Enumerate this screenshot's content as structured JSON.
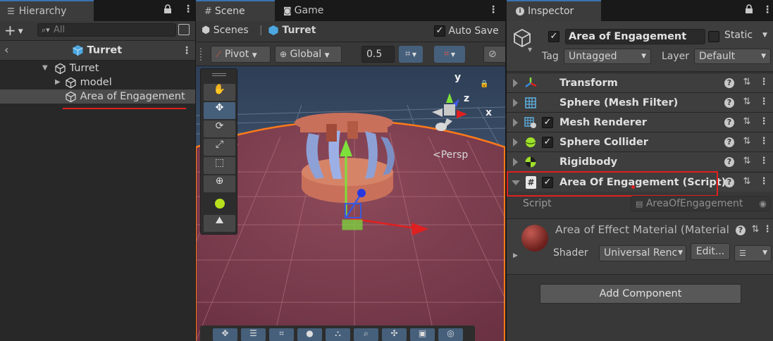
{
  "hierarchy": {
    "tab_label": "Hierarchy",
    "search_placeholder": "All",
    "scene_root": "Turret",
    "items": [
      {
        "label": "Turret"
      },
      {
        "label": "model"
      },
      {
        "label": "Area of Engagement"
      }
    ]
  },
  "scene": {
    "tab_label": "Scene",
    "game_tab_label": "Game",
    "breadcrumb_root": "Scenes",
    "breadcrumb_current": "Turret",
    "auto_save_label": "Auto Save",
    "pivot_label": "Pivot",
    "global_label": "Global",
    "snap_value": "0.5",
    "persp_label": "<Persp",
    "gizmo_axes": {
      "x": "x",
      "y": "y",
      "z": "z"
    }
  },
  "inspector": {
    "tab_label": "Inspector",
    "object_name": "Area of Engagement",
    "static_label": "Static",
    "tag_label": "Tag",
    "tag_value": "Untagged",
    "layer_label": "Layer",
    "layer_value": "Default",
    "components": [
      {
        "name": "Transform"
      },
      {
        "name": "Sphere (Mesh Filter)"
      },
      {
        "name": "Mesh Renderer"
      },
      {
        "name": "Sphere Collider"
      },
      {
        "name": "Rigidbody"
      },
      {
        "name": "Area Of Engagement (Script)"
      }
    ],
    "script_label": "Script",
    "script_value": "AreaOfEngagement",
    "material_name": "Area of Effect Material (Material",
    "shader_label": "Shader",
    "shader_value": "Universal Renc",
    "edit_label": "Edit...",
    "add_component_label": "Add Component"
  },
  "colors": {
    "accent": "#3a72b0",
    "highlight_red": "#e0201e",
    "selection_orange": "#ff7a1a"
  }
}
